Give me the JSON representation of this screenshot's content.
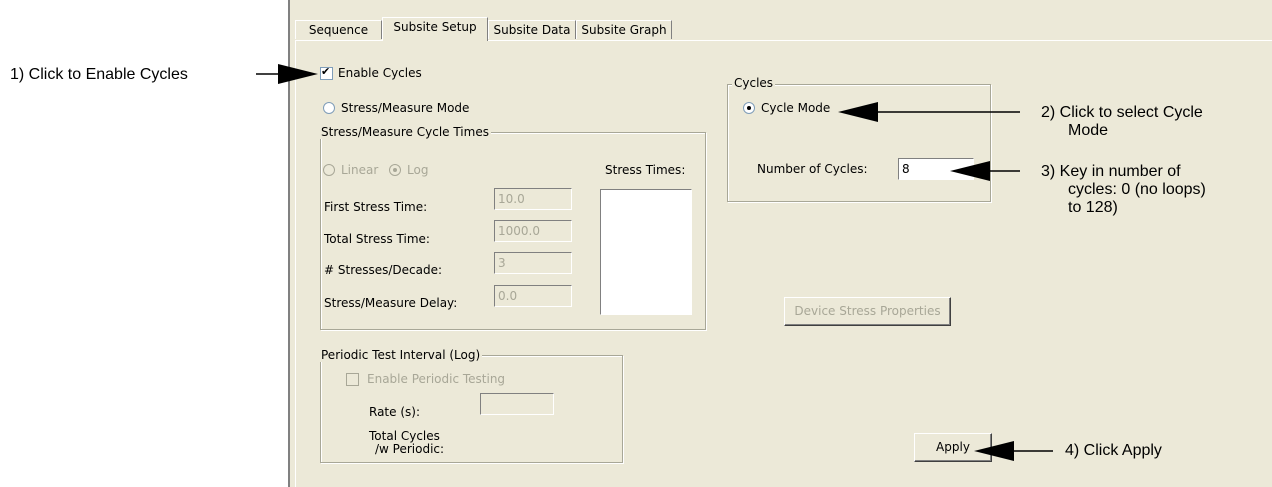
{
  "tabs": [
    "Sequence",
    "Subsite Setup",
    "Subsite Data",
    "Subsite Graph"
  ],
  "enable_cycles_label": "Enable Cycles",
  "stress_measure_mode_label": "Stress/Measure Mode",
  "cycle_mode_label": "Cycle Mode",
  "stress_group": {
    "title": "Stress/Measure Cycle Times",
    "linear_label": "Linear",
    "log_label": "Log",
    "stress_times_label": "Stress Times:",
    "first_stress_label": "First Stress Time:",
    "first_stress_value": "10.0",
    "total_stress_label": "Total Stress Time:",
    "total_stress_value": "1000.0",
    "stresses_decade_label": "# Stresses/Decade:",
    "stresses_decade_value": "3",
    "delay_label": "Stress/Measure Delay:",
    "delay_value": "0.0"
  },
  "cycles_group": {
    "title": "Cycles",
    "num_label": "Number of Cycles:",
    "num_value": "8"
  },
  "device_stress_button": "Device Stress Properties",
  "periodic_group": {
    "title": "Periodic Test Interval (Log)",
    "enable_label": "Enable Periodic Testing",
    "rate_label": "Rate (s):",
    "total_cycles_line1": "Total Cycles",
    "total_cycles_line2": "/w Periodic:"
  },
  "apply_button": "Apply",
  "annotations": {
    "a1": "1)  Click to Enable Cycles",
    "a2_line1": "2)  Click to select Cycle",
    "a2_line2": "Mode",
    "a3_line1": "3)  Key in number of",
    "a3_line2": "cycles: 0 (no loops)",
    "a3_line3": "to 128)",
    "a4": "4)  Click Apply"
  }
}
